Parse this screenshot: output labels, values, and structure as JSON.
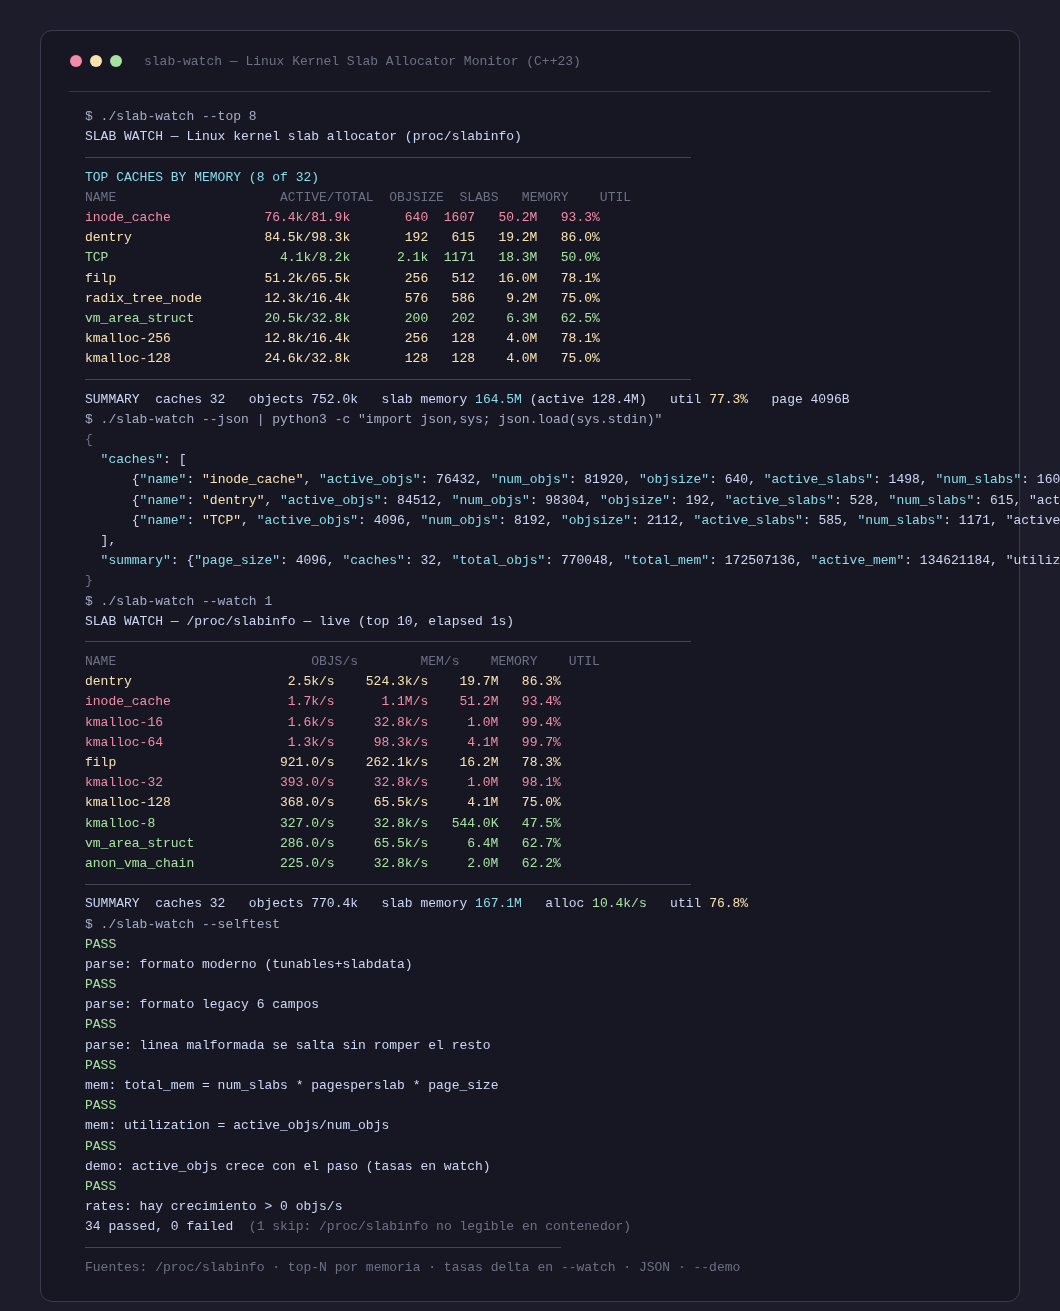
{
  "window": {
    "title": "slab-watch — Linux Kernel Slab Allocator Monitor (C++23)"
  },
  "blocks": [
    {
      "kind": "command",
      "text": "$ ./slab-watch --top 8"
    },
    {
      "kind": "text",
      "text": "SLAB WATCH — Linux kernel slab allocator (proc/slabinfo)"
    },
    {
      "kind": "table",
      "heading": "TOP CACHES BY MEMORY (8 of 32)",
      "columns": [
        "NAME",
        "ACTIVE/TOTAL",
        "OBJSIZE",
        "SLABS",
        "MEMORY",
        "UTIL"
      ],
      "rows": [
        {
          "color": "#f38ba8",
          "cells": [
            "inode_cache",
            "76.4k/81.9k",
            "640",
            "1607",
            "50.2M",
            "93.3%"
          ]
        },
        {
          "color": "#f9e2af",
          "cells": [
            "dentry",
            "84.5k/98.3k",
            "192",
            "615",
            "19.2M",
            "86.0%"
          ]
        },
        {
          "color": "#a6e3a1",
          "cells": [
            "TCP",
            "4.1k/8.2k",
            "2.1k",
            "1171",
            "18.3M",
            "50.0%"
          ]
        },
        {
          "color": "#f9e2af",
          "cells": [
            "filp",
            "51.2k/65.5k",
            "256",
            "512",
            "16.0M",
            "78.1%"
          ]
        },
        {
          "color": "#f9e2af",
          "cells": [
            "radix_tree_node",
            "12.3k/16.4k",
            "576",
            "586",
            "9.2M",
            "75.0%"
          ]
        },
        {
          "color": "#a6e3a1",
          "cells": [
            "vm_area_struct",
            "20.5k/32.8k",
            "200",
            "202",
            "6.3M",
            "62.5%"
          ]
        },
        {
          "color": "#f9e2af",
          "cells": [
            "kmalloc-256",
            "12.8k/16.4k",
            "256",
            "128",
            "4.0M",
            "78.1%"
          ]
        },
        {
          "color": "#f9e2af",
          "cells": [
            "kmalloc-128",
            "24.6k/32.8k",
            "128",
            "128",
            "4.0M",
            "75.0%"
          ]
        }
      ]
    },
    {
      "kind": "summary",
      "segments": [
        {
          "text": "SUMMARY  caches 32   objects 752.0k   slab memory "
        },
        {
          "text": "164.5M",
          "color": "#89dceb"
        },
        {
          "text": " (active 128.4M)   util "
        },
        {
          "text": "77.3%",
          "color": "#f9e2af"
        },
        {
          "text": "   page 4096B"
        }
      ]
    },
    {
      "kind": "command",
      "text": "$ ./slab-watch --json | python3 -c \"import json,sys; json.load(sys.stdin)\""
    },
    {
      "kind": "json",
      "lines": [
        {
          "kind": "brace",
          "text": "{"
        },
        {
          "kind": "body",
          "text": "  \"caches\": ["
        },
        {
          "kind": "body",
          "text": "      {\"name\": \"inode_cache\", \"active_objs\": 76432, \"num_objs\": 81920, \"objsize\": 640, \"active_slabs\": 1498, \"num_slabs\": 160"
        },
        {
          "kind": "body",
          "text": "      {\"name\": \"dentry\", \"active_objs\": 84512, \"num_objs\": 98304, \"objsize\": 192, \"active_slabs\": 528, \"num_slabs\": 615, \"act"
        },
        {
          "kind": "body",
          "text": "      {\"name\": \"TCP\", \"active_objs\": 4096, \"num_objs\": 8192, \"objsize\": 2112, \"active_slabs\": 585, \"num_slabs\": 1171, \"active"
        },
        {
          "kind": "body",
          "text": "  ],"
        },
        {
          "kind": "body",
          "text": "  \"summary\": {\"page_size\": 4096, \"caches\": 32, \"total_objs\": 770048, \"total_mem\": 172507136, \"active_mem\": 134621184, \"utiliz"
        },
        {
          "kind": "brace",
          "text": "}"
        }
      ]
    },
    {
      "kind": "command",
      "text": "$ ./slab-watch --watch 1"
    },
    {
      "kind": "text",
      "text": "SLAB WATCH — /proc/slabinfo — live (top 10, elapsed 1s)"
    },
    {
      "kind": "table",
      "columns": [
        "NAME",
        "OBJS/s",
        "MEM/s",
        "MEMORY",
        "UTIL"
      ],
      "rows": [
        {
          "color": "#f9e2af",
          "cells": [
            "dentry",
            "2.5k/s",
            "524.3k/s",
            "19.7M",
            "86.3%"
          ]
        },
        {
          "color": "#f38ba8",
          "cells": [
            "inode_cache",
            "1.7k/s",
            "1.1M/s",
            "51.2M",
            "93.4%"
          ]
        },
        {
          "color": "#f38ba8",
          "cells": [
            "kmalloc-16",
            "1.6k/s",
            "32.8k/s",
            "1.0M",
            "99.4%"
          ]
        },
        {
          "color": "#f38ba8",
          "cells": [
            "kmalloc-64",
            "1.3k/s",
            "98.3k/s",
            "4.1M",
            "99.7%"
          ]
        },
        {
          "color": "#f9e2af",
          "cells": [
            "filp",
            "921.0/s",
            "262.1k/s",
            "16.2M",
            "78.3%"
          ]
        },
        {
          "color": "#f38ba8",
          "cells": [
            "kmalloc-32",
            "393.0/s",
            "32.8k/s",
            "1.0M",
            "98.1%"
          ]
        },
        {
          "color": "#f9e2af",
          "cells": [
            "kmalloc-128",
            "368.0/s",
            "65.5k/s",
            "4.1M",
            "75.0%"
          ]
        },
        {
          "color": "#a6e3a1",
          "cells": [
            "kmalloc-8",
            "327.0/s",
            "32.8k/s",
            "544.0K",
            "47.5%"
          ]
        },
        {
          "color": "#a6e3a1",
          "cells": [
            "vm_area_struct",
            "286.0/s",
            "65.5k/s",
            "6.4M",
            "62.7%"
          ]
        },
        {
          "color": "#a6e3a1",
          "cells": [
            "anon_vma_chain",
            "225.0/s",
            "32.8k/s",
            "2.0M",
            "62.2%"
          ]
        }
      ]
    },
    {
      "kind": "summary",
      "segments": [
        {
          "text": "SUMMARY  caches 32   objects 770.4k   slab memory "
        },
        {
          "text": "167.1M",
          "color": "#89dceb"
        },
        {
          "text": "   alloc "
        },
        {
          "text": "10.4k/s",
          "color": "#a6e3a1"
        },
        {
          "text": "   util "
        },
        {
          "text": "76.8%",
          "color": "#f9e2af"
        }
      ]
    },
    {
      "kind": "command",
      "text": "$ ./slab-watch --selftest"
    },
    {
      "kind": "pass",
      "text": "PASS"
    },
    {
      "kind": "text",
      "text": "parse: formato moderno (tunables+slabdata)"
    },
    {
      "kind": "pass",
      "text": "PASS"
    },
    {
      "kind": "text",
      "text": "parse: formato legacy 6 campos"
    },
    {
      "kind": "pass",
      "text": "PASS"
    },
    {
      "kind": "text",
      "text": "parse: linea malformada se salta sin romper el resto"
    },
    {
      "kind": "pass",
      "text": "PASS"
    },
    {
      "kind": "text",
      "text": "mem: total_mem = num_slabs * pagesperslab * page_size"
    },
    {
      "kind": "pass",
      "text": "PASS"
    },
    {
      "kind": "text",
      "text": "mem: utilization = active_objs/num_objs"
    },
    {
      "kind": "pass",
      "text": "PASS"
    },
    {
      "kind": "text",
      "text": "demo: active_objs crece con el paso (tasas en watch)"
    },
    {
      "kind": "pass",
      "text": "PASS"
    },
    {
      "kind": "text",
      "text": "rates: hay crecimiento > 0 objs/s"
    },
    {
      "kind": "result",
      "text": "34 passed, 0 failed",
      "note": "(1 skip: /proc/slabinfo no legible en contenedor)"
    },
    {
      "kind": "footer",
      "text": "Fuentes: /proc/slabinfo · top-N por memoria · tasas delta en --watch · JSON · --demo"
    }
  ]
}
